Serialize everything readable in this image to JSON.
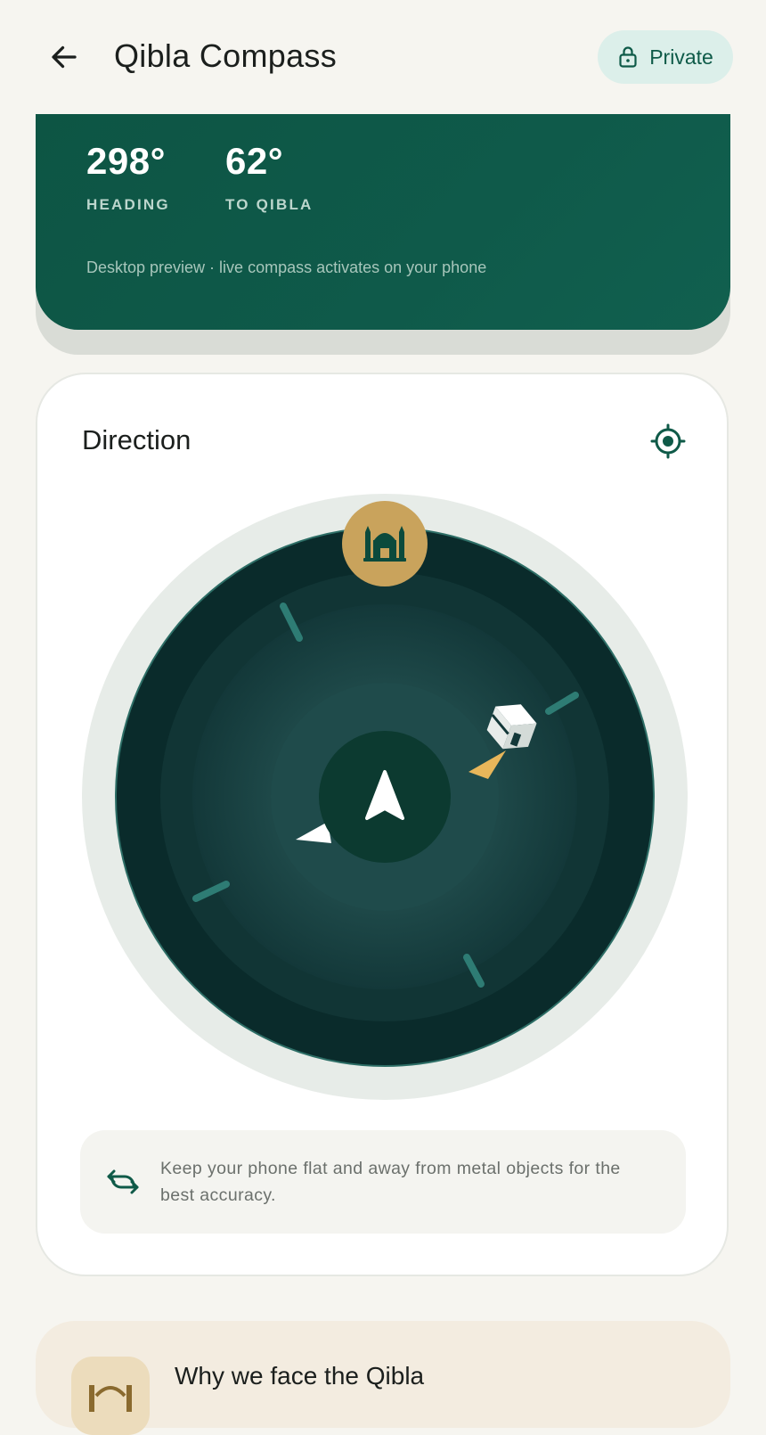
{
  "header": {
    "title": "Qibla Compass",
    "privacy_label": "Private"
  },
  "hero": {
    "heading_value": "298°",
    "heading_label": "HEADING",
    "qibla_value": "62°",
    "qibla_label": "TO QIBLA",
    "note": "Desktop preview · live compass activates on your phone"
  },
  "direction": {
    "title": "Direction",
    "tip": "Keep your phone flat and away from metal objects for the best accuracy."
  },
  "why": {
    "title": "Why we face the Qibla"
  },
  "colors": {
    "brand": "#0f5a48",
    "gold": "#c9a35c",
    "compass_dark": "#0a2b2b"
  },
  "icons": {
    "back": "arrow-left-icon",
    "privacy": "lock-icon",
    "locate": "gps-target-icon",
    "qibla_marker": "mosque-icon",
    "kaaba": "kaaba-icon",
    "heading": "navigation-arrow-icon",
    "calibrate": "rotate-arrows-icon"
  }
}
